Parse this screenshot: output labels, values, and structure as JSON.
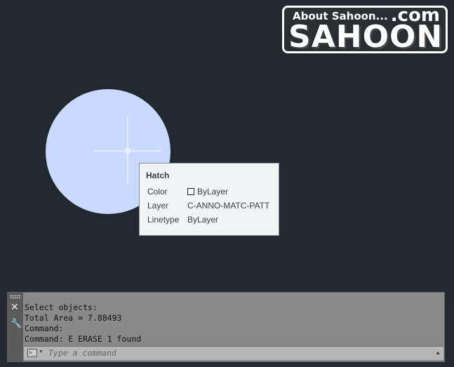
{
  "logo": {
    "about": "About Sahoon...",
    "com": ".com",
    "brand": "SAHOON"
  },
  "canvas": {
    "hatch_color": "#c9d9ff",
    "crosshair_color": "#ffffff"
  },
  "tooltip": {
    "title": "Hatch",
    "rows": [
      {
        "label": "Color",
        "value": "ByLayer"
      },
      {
        "label": "Layer",
        "value": "C-ANNO-MATC-PATT"
      },
      {
        "label": "Linetype",
        "value": "ByLayer"
      }
    ]
  },
  "command_line": {
    "history": [
      "Select objects:",
      "Total Area = 7.88493",
      "Command:",
      "Command: E ERASE 1 found"
    ],
    "placeholder": "Type a command",
    "close_icon": "close-icon",
    "settings_icon": "wrench-icon"
  }
}
